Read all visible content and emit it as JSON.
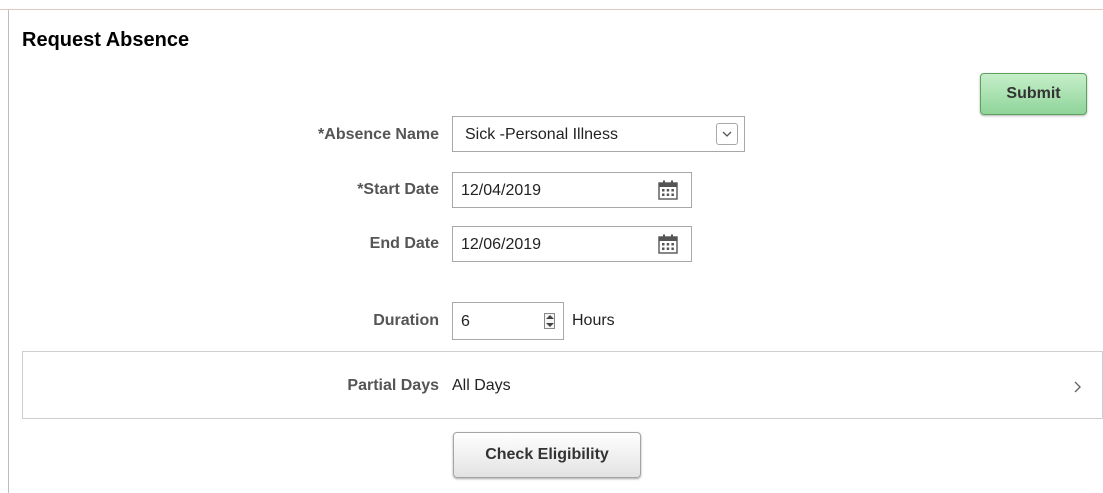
{
  "page": {
    "header_fragment": "",
    "title": "Request Absence"
  },
  "actions": {
    "submit_label": "Submit",
    "check_eligibility_label": "Check Eligibility"
  },
  "form": {
    "absence_name": {
      "label": "*Absence Name",
      "value": "Sick -Personal Illness"
    },
    "start_date": {
      "label": "*Start Date",
      "value": "12/04/2019"
    },
    "end_date": {
      "label": "End Date",
      "value": "12/06/2019"
    },
    "duration": {
      "label": "Duration",
      "value": "6",
      "unit": "Hours"
    },
    "partial_days": {
      "label": "Partial Days",
      "value": "All Days"
    }
  },
  "icons": {
    "calendar": "calendar-icon",
    "dropdown": "chevron-down-icon",
    "spinner": "spinner-icon",
    "chevron_right": "chevron-right-icon"
  },
  "colors": {
    "submit_green_top": "#c6efc9",
    "submit_green_bottom": "#8fd49a"
  }
}
